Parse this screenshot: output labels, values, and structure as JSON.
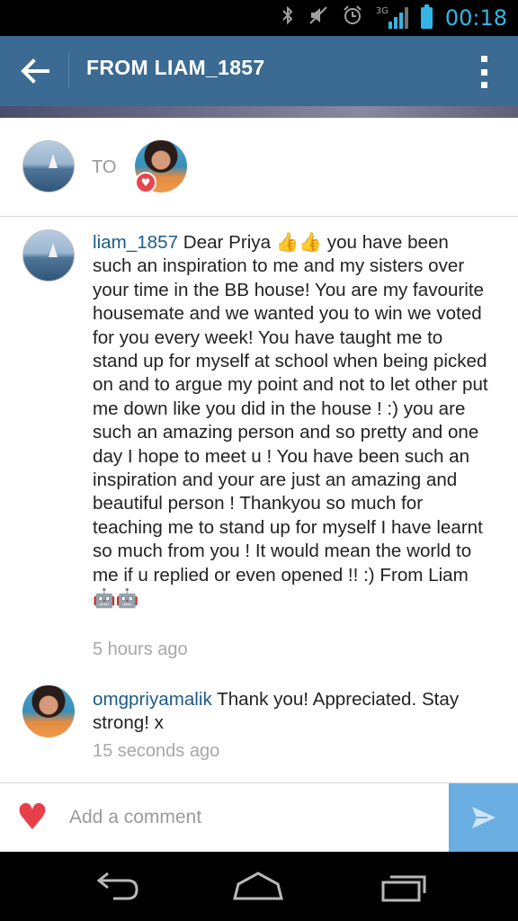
{
  "status_bar": {
    "network_label": "3G",
    "time": "00:18",
    "icons": [
      "bluetooth-icon",
      "mute-icon",
      "alarm-icon",
      "signal-icon",
      "battery-icon"
    ]
  },
  "action_bar": {
    "title": "FROM LIAM_1857",
    "back_icon": "back-arrow-icon",
    "overflow_icon": "overflow-menu-icon"
  },
  "recipients": {
    "to_label": "TO"
  },
  "comments": [
    {
      "username": "liam_1857",
      "text": "Dear Priya 👍👍 you have been such an inspiration to me and my sisters over your time in the BB house! You are my favourite housemate and we wanted you to win we voted for you every week! You have taught me to stand up for myself at school when being picked on and to argue my point and not to let other put me down like you did in the house ! :) you are such an amazing person and so pretty and one day I hope to meet u ! You have been such an inspiration and your are just an amazing and beautiful person ! Thankyou so much for teaching me to stand up for myself I have learnt so much from you ! It would mean the world to me if u replied or even opened !! :) From Liam 🤖🤖",
      "time": "5 hours ago"
    },
    {
      "username": "omgpriyamalik",
      "text": "Thank you! Appreciated. Stay strong! x",
      "time": "15 seconds ago"
    }
  ],
  "comment_bar": {
    "placeholder": "Add a comment",
    "heart_icon": "heart-icon",
    "send_icon": "send-icon"
  },
  "colors": {
    "action_bar": "#3b6a92",
    "username": "#1c5b8a",
    "heart": "#e7404a",
    "send_button": "#6aaee2",
    "clock": "#33b5e5"
  }
}
